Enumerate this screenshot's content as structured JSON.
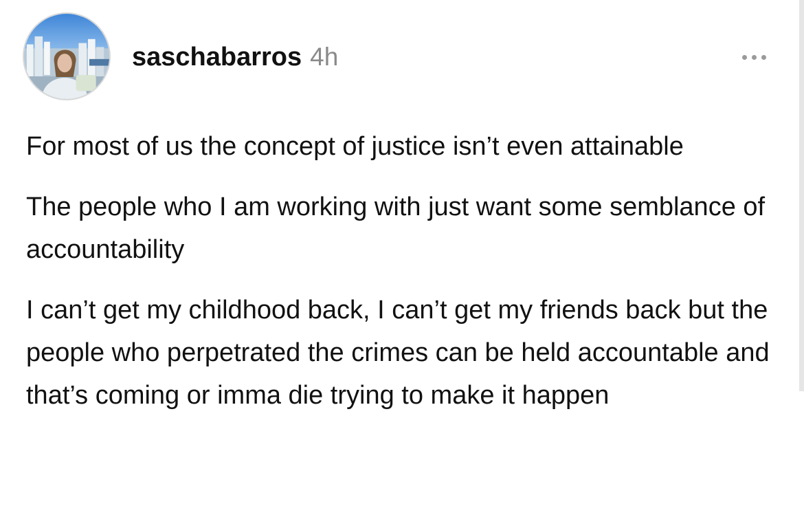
{
  "post": {
    "author": {
      "username": "saschabarros",
      "timestamp": "4h"
    },
    "more_icon": "more-horizontal-icon",
    "paragraphs": [
      "For most of us the concept of justice isn’t even attainable",
      "The people who I am working with just want some semblance of accountability",
      "I can’t get my childhood back, I can’t get my friends back but the people who perpetrated the crimes can be held accountable and that’s coming or imma die trying to make it happen"
    ]
  },
  "colors": {
    "text": "#111111",
    "timestamp": "#8a8a8a",
    "icon": "#9a9a9a",
    "background": "#ffffff"
  }
}
